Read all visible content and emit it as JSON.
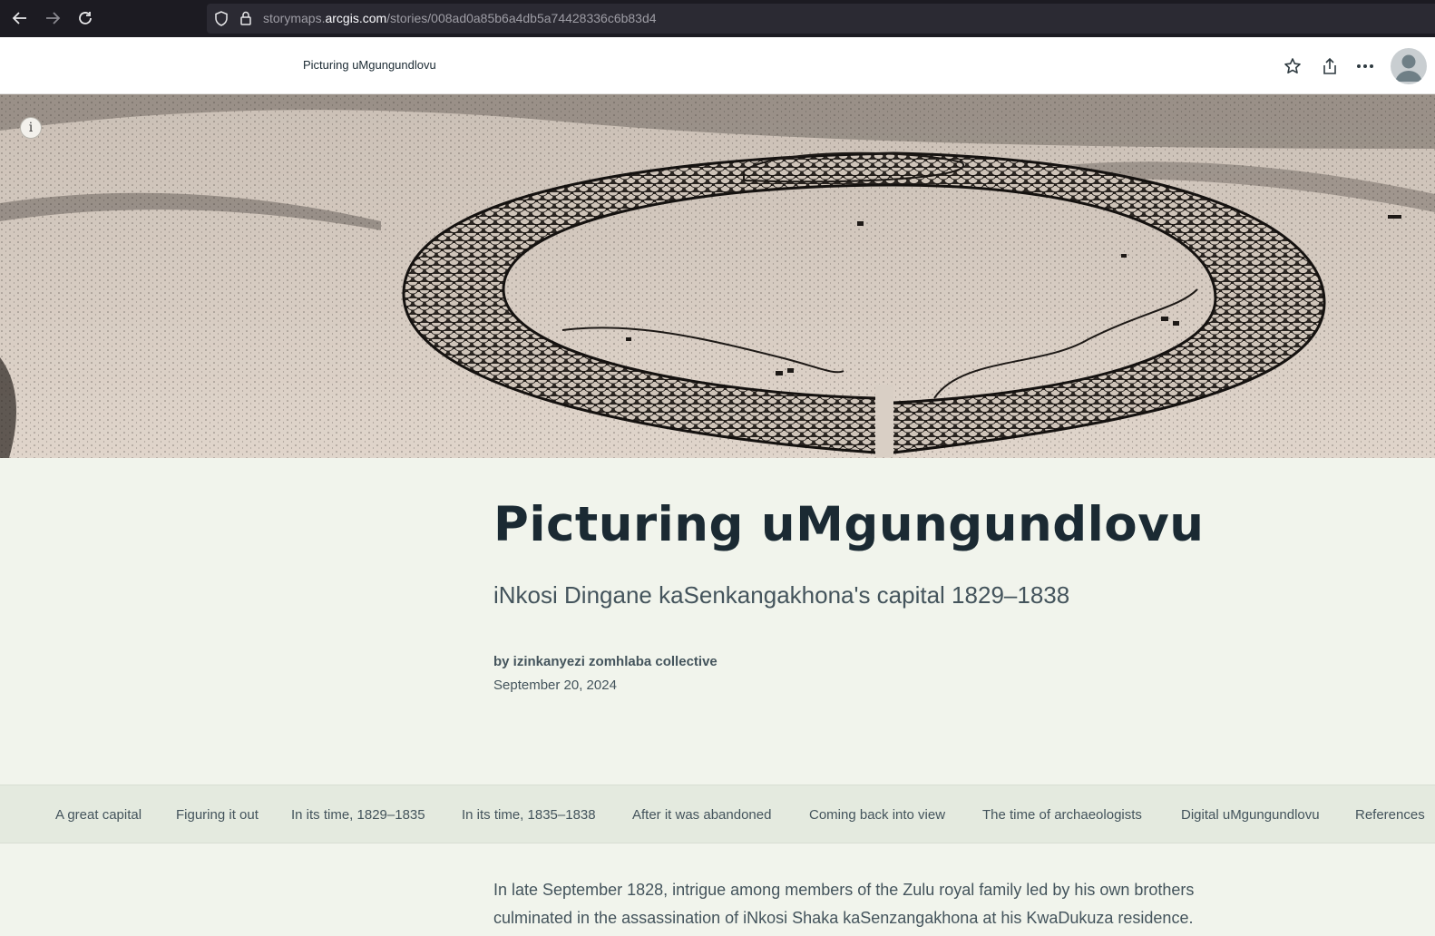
{
  "browser": {
    "url_prefix": "storymaps.",
    "url_host": "arcgis.com",
    "url_path": "/stories/008ad0a85b6a4db5a74428336c6b83d4",
    "icons": [
      "back-arrow-icon",
      "forward-arrow-icon",
      "reload-icon",
      "shield-icon",
      "lock-icon"
    ]
  },
  "header": {
    "story_title": "Picturing uMgungundlovu",
    "icons": [
      "star-icon",
      "share-icon",
      "more-icon",
      "avatar"
    ]
  },
  "hero": {
    "info_label": "i"
  },
  "story": {
    "title": "Picturing uMgungundlovu",
    "subtitle": "iNkosi Dingane kaSenkangakhona's capital 1829–1838",
    "byline": "by izinkanyezi zomhlaba collective",
    "date": "September 20, 2024"
  },
  "section_nav": {
    "items": [
      "A great capital",
      "Figuring it out",
      "In its time, 1829–1835",
      "In its time, 1835–1838",
      "After it was abandoned",
      "Coming back into view",
      "The time of archaeologists",
      "Digital uMgungundlovu",
      "References"
    ]
  },
  "body": {
    "paragraph": "In late September 1828, intrigue among members of the Zulu royal family led by his own brothers culminated in the assassination of iNkosi Shaka kaSenzangakhona at his KwaDukuza residence."
  },
  "colors": {
    "page_bg": "#f1f4ec",
    "title": "#1b2a33",
    "text": "#44545c",
    "nav_bg": "#e4eadf"
  }
}
